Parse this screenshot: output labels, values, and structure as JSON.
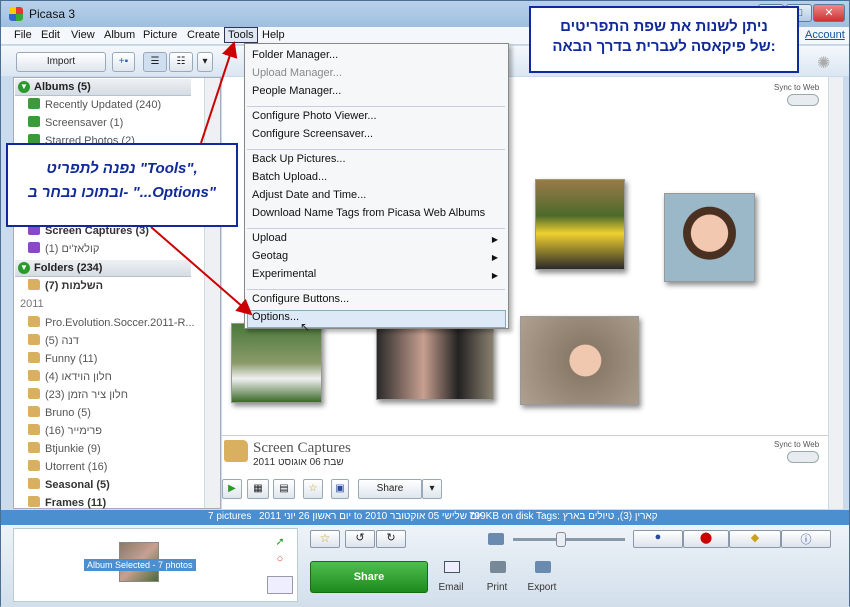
{
  "app": {
    "title": "Picasa 3"
  },
  "menu": [
    "File",
    "Edit",
    "View",
    "Album",
    "Picture",
    "Create",
    "Tools",
    "Help"
  ],
  "account_link": "Account",
  "toolbar": {
    "import_label": "Import"
  },
  "sidebar": {
    "albums_header": "Albums (5)",
    "albums": [
      {
        "label": "Recently Updated (240)"
      },
      {
        "label": "Screensaver (1)"
      },
      {
        "label": "Starred Photos (2)"
      },
      {
        "label": "Screen Captures (3)"
      },
      {
        "label": "קולאז'ים (1)"
      }
    ],
    "folders_header": "Folders (234)",
    "folders": [
      {
        "label": "השלמות (7)"
      },
      {
        "label": "2011"
      },
      {
        "label": "Pro.Evolution.Soccer.2011-R..."
      },
      {
        "label": "דנה (5)"
      },
      {
        "label": "Funny (11)"
      },
      {
        "label": "חלון הוידאו (4)"
      },
      {
        "label": "חלון ציר הזמן (23)"
      },
      {
        "label": "Bruno (5)"
      },
      {
        "label": "פרימייר (16)"
      },
      {
        "label": "Btjunkie (9)"
      },
      {
        "label": "Utorrent (16)"
      },
      {
        "label": "Seasonal (5)"
      },
      {
        "label": "Frames (11)"
      }
    ]
  },
  "tools_menu": {
    "items": [
      {
        "label": "Folder Manager..."
      },
      {
        "label": "Upload Manager..."
      },
      {
        "label": "People Manager..."
      },
      {
        "label": "Configure Photo Viewer..."
      },
      {
        "label": "Configure Screensaver..."
      },
      {
        "label": "Back Up Pictures..."
      },
      {
        "label": "Batch Upload..."
      },
      {
        "label": "Adjust Date and Time..."
      },
      {
        "label": "Download Name Tags from Picasa Web Albums"
      },
      {
        "label": "Upload"
      },
      {
        "label": "Geotag"
      },
      {
        "label": "Experimental"
      },
      {
        "label": "Configure Buttons..."
      },
      {
        "label": "Options..."
      }
    ]
  },
  "main": {
    "sync_label": "Sync to Web",
    "sync_label_2": "Sync to Web",
    "album_title": "Screen Captures",
    "album_date": "שבת 06 אוגוסט 2011",
    "share_label": "Share"
  },
  "callouts": {
    "top": "ניתן לשנות את שפת התפריטים\nשל פיקאסה לעברית בדרך הבאה:",
    "left": "נפנה לתפריט \"Tools\",\nובתוכו נבחר ב- \"...Options\""
  },
  "status": {
    "count": "7 pictures",
    "range": "יום ראשון 26 יוני 2011 to יום שלישי 05 אוקטובר 2010",
    "disk": "799KB on disk",
    "tags": "Tags: קארין (3), טיולים בארץ"
  },
  "bottom": {
    "selection_label": "Album Selected - 7 photos",
    "share_label": "Share",
    "email_label": "Email",
    "print_label": "Print",
    "export_label": "Export"
  },
  "colors": {
    "accent_green": "#2a9a2a",
    "status_blue": "#4c8fd1",
    "callout_blue": "#102a9a",
    "callout_red": "#dd0000"
  }
}
